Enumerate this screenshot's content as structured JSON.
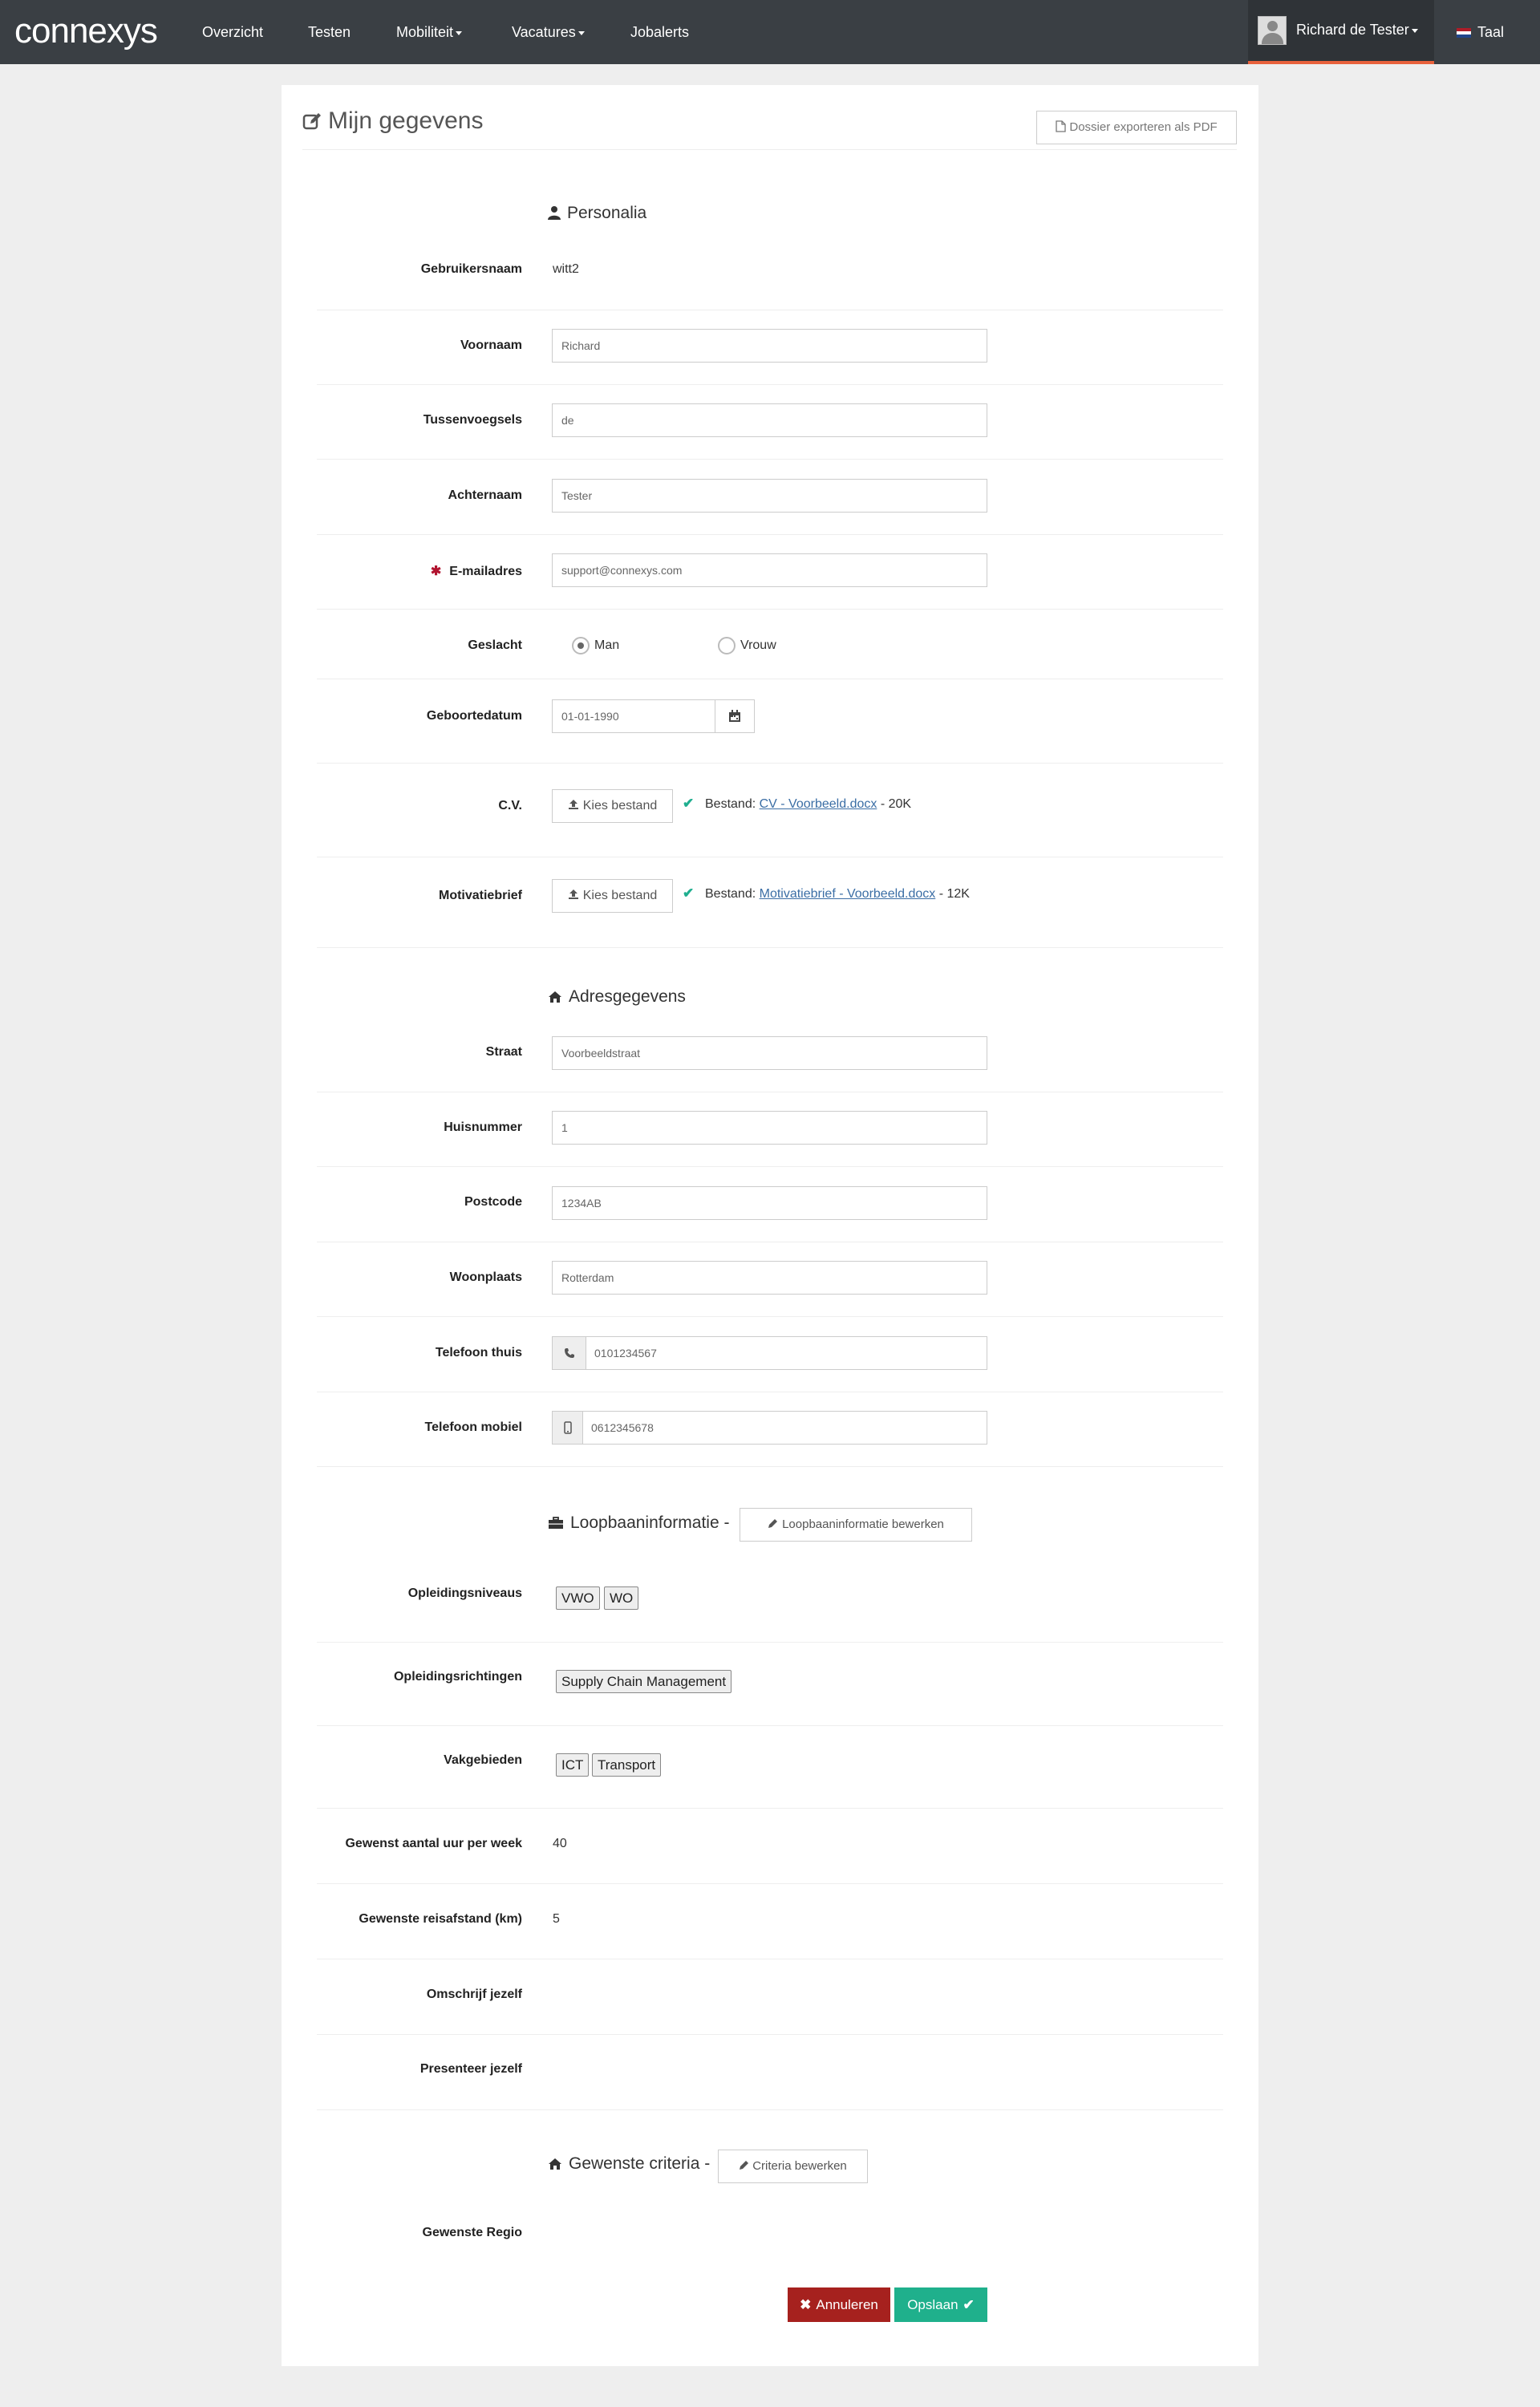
{
  "nav": {
    "logo": "connexys",
    "items": [
      "Overzicht",
      "Testen",
      "Mobiliteit",
      "Vacatures",
      "Jobalerts"
    ],
    "user": "Richard de Tester",
    "language": "Taal"
  },
  "page": {
    "title": "Mijn gegevens",
    "export_label": "Dossier exporteren als PDF"
  },
  "personalia": {
    "heading": "Personalia",
    "username_label": "Gebruikersnaam",
    "username": "witt2",
    "first_name_label": "Voornaam",
    "first_name": "Richard",
    "infix_label": "Tussenvoegsels",
    "infix": "de",
    "last_name_label": "Achternaam",
    "last_name": "Tester",
    "email_label": "E-mailadres",
    "email": "support@connexys.com",
    "gender_label": "Geslacht",
    "gender_male": "Man",
    "gender_female": "Vrouw",
    "birthdate_label": "Geboortedatum",
    "birthdate": "01-01-1990",
    "cv_label": "C.V.",
    "choose_file": "Kies bestand",
    "file_prefix": "Bestand:",
    "cv_file": "CV - Voorbeeld.docx",
    "cv_size": "- 20K",
    "motivation_label": "Motivatiebrief",
    "motivation_file": "Motivatiebrief - Voorbeeld.docx",
    "motivation_size": "- 12K"
  },
  "address": {
    "heading": "Adresgegevens",
    "street_label": "Straat",
    "street": "Voorbeeldstraat",
    "number_label": "Huisnummer",
    "number": "1",
    "postcode_label": "Postcode",
    "postcode": "1234AB",
    "city_label": "Woonplaats",
    "city": "Rotterdam",
    "phone_home_label": "Telefoon thuis",
    "phone_home": "0101234567",
    "phone_mobile_label": "Telefoon mobiel",
    "phone_mobile": "0612345678"
  },
  "career": {
    "heading": "Loopbaaninformatie -",
    "edit_label": "Loopbaaninformatie bewerken",
    "levels_label": "Opleidingsniveaus",
    "levels": [
      "VWO",
      "WO"
    ],
    "directions_label": "Opleidingsrichtingen",
    "directions": [
      "Supply Chain Management"
    ],
    "fields_label": "Vakgebieden",
    "fields": [
      "ICT",
      "Transport"
    ],
    "hours_label": "Gewenst aantal uur per week",
    "hours": "40",
    "distance_label": "Gewenste reisafstand (km)",
    "distance": "5",
    "describe_label": "Omschrijf jezelf",
    "present_label": "Presenteer jezelf"
  },
  "criteria": {
    "heading": "Gewenste criteria -",
    "edit_label": "Criteria bewerken",
    "region_label": "Gewenste Regio"
  },
  "actions": {
    "cancel": "Annuleren",
    "save": "Opslaan"
  },
  "colors": {
    "navbar": "#3a3f44",
    "accent": "#e8613c",
    "cancel": "#a6211e",
    "save": "#1fb08c",
    "check": "#1fae8f",
    "required": "#b1132f"
  }
}
